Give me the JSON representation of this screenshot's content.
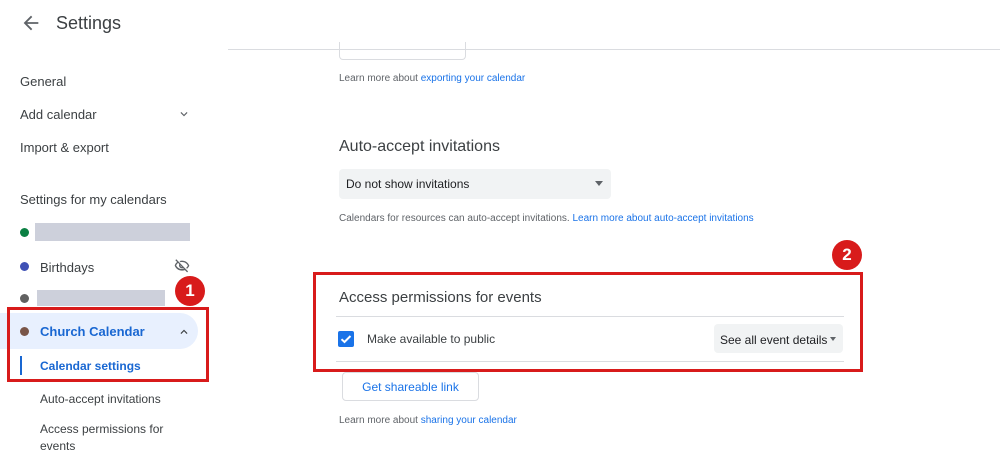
{
  "header": {
    "title": "Settings"
  },
  "sidebar": {
    "general": "General",
    "add_calendar": "Add calendar",
    "import_export": "Import & export",
    "section_title": "Settings for my calendars",
    "calendars": [
      {
        "label": "",
        "color": "#0b8043"
      },
      {
        "label": "Birthdays",
        "color": "#3f51b5"
      },
      {
        "label": "",
        "color": "#616161"
      },
      {
        "label": "Church Calendar",
        "color": "#795548"
      }
    ],
    "sub_items": [
      "Calendar settings",
      "Auto-accept invitations",
      "Access permissions for events"
    ]
  },
  "main": {
    "export_note": {
      "prefix": "Learn more about ",
      "link": "exporting your calendar"
    },
    "auto_accept": {
      "title": "Auto-accept invitations",
      "select_value": "Do not show invitations",
      "note_prefix": "Calendars for resources can auto-accept invitations. ",
      "note_link": "Learn more about auto-accept invitations"
    },
    "access": {
      "title": "Access permissions for events",
      "checkbox_label": "Make available to public",
      "checked": true,
      "details_select": "See all event details",
      "share_button": "Get shareable link",
      "note_prefix": "Learn more about ",
      "note_link": "sharing your calendar"
    }
  },
  "annotations": {
    "badge_1": "1",
    "badge_2": "2",
    "color": "#d81b1b"
  }
}
